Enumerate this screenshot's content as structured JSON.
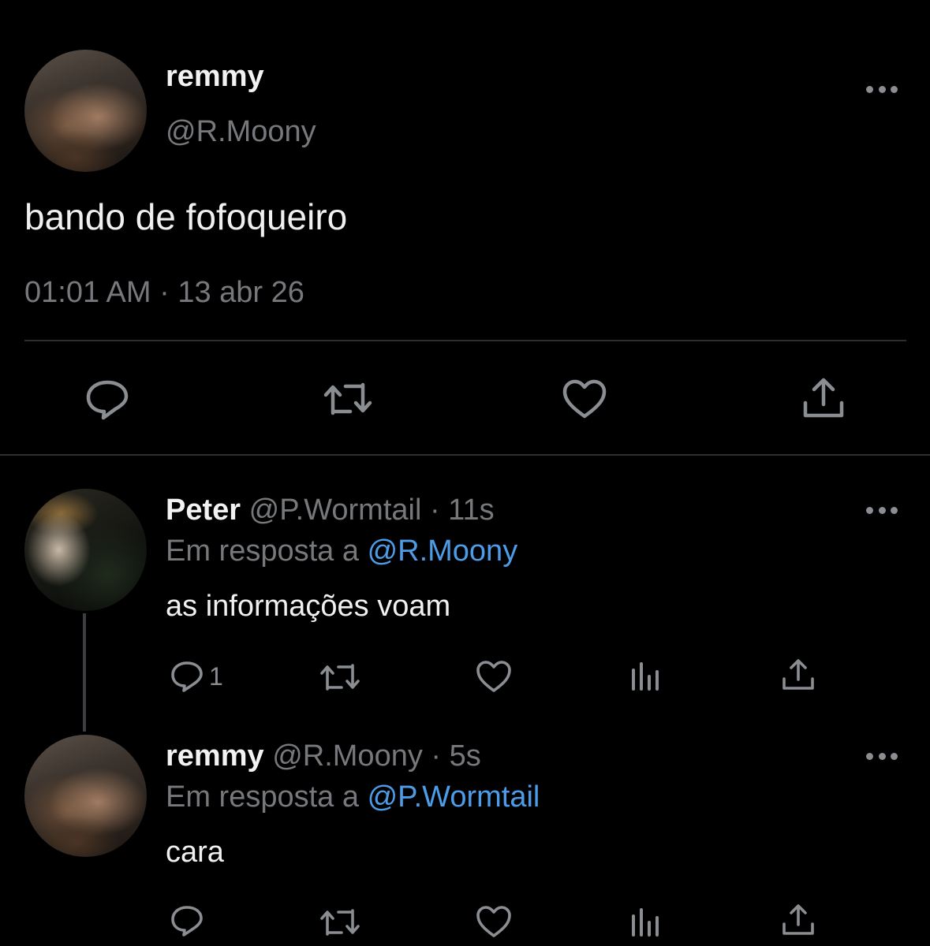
{
  "main_tweet": {
    "name": "remmy",
    "handle": "@R.Moony",
    "text": "bando de fofoqueiro",
    "timestamp": "01:01 AM · 13 abr 26",
    "actions": [
      "reply-icon",
      "retweet-icon",
      "like-icon",
      "share-icon"
    ]
  },
  "replies": [
    {
      "name": "Peter",
      "handle": "@P.Wormtail",
      "time": "· 11s",
      "replying_prefix": "Em resposta a",
      "replying_to": "@R.Moony",
      "text": "as informações voam",
      "reply_count": "1",
      "actions": [
        "reply-icon",
        "retweet-icon",
        "like-icon",
        "analytics-icon",
        "share-icon"
      ]
    },
    {
      "name": "remmy",
      "handle": "@R.Moony",
      "time": "· 5s",
      "replying_prefix": "Em resposta a",
      "replying_to": "@P.Wormtail",
      "text": "cara",
      "reply_count": "",
      "actions": [
        "reply-icon",
        "retweet-icon",
        "like-icon",
        "analytics-icon",
        "share-icon"
      ]
    }
  ],
  "colors": {
    "background": "#000000",
    "text": "#f0f0f0",
    "muted": "#76787c",
    "link": "#4d9ce8",
    "divider": "#2d2f33"
  }
}
